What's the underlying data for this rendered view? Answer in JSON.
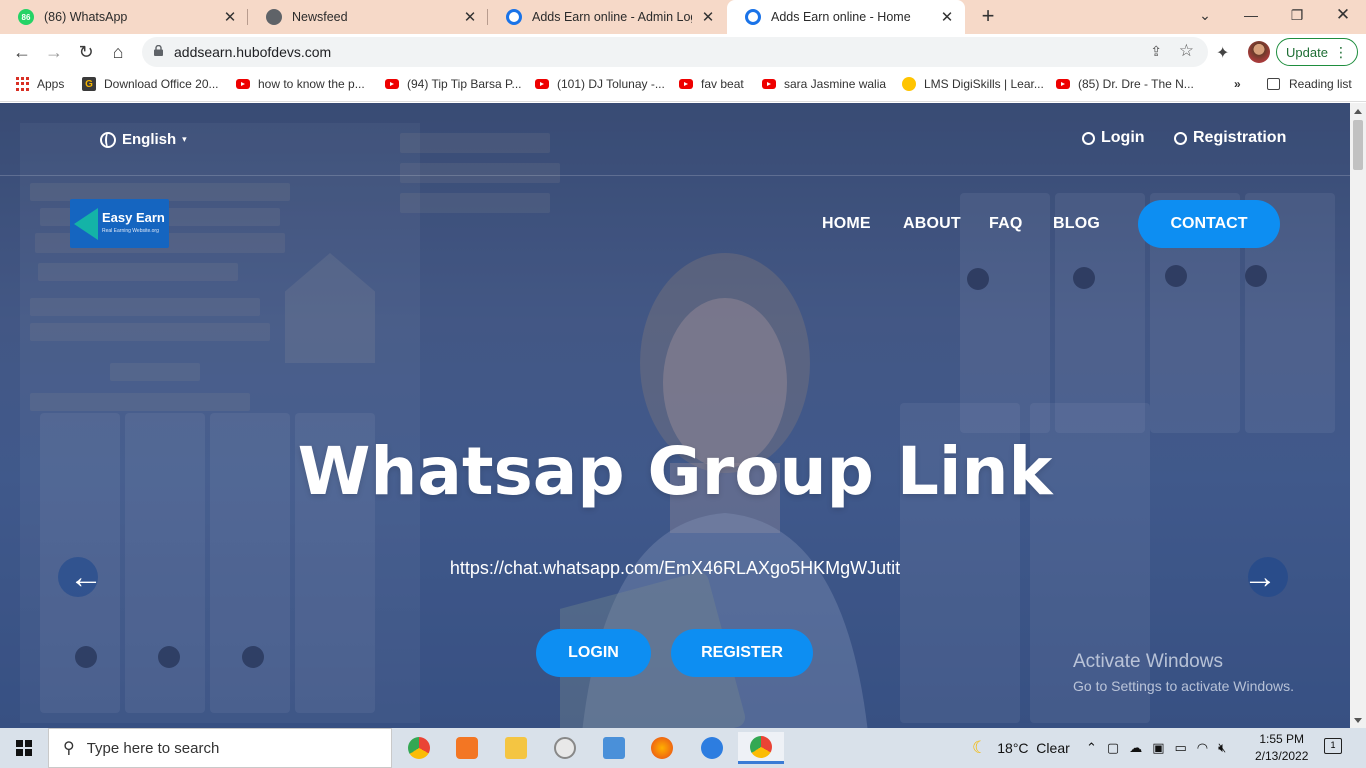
{
  "browser": {
    "tabs": [
      {
        "title": "(86) WhatsApp",
        "badge": "86",
        "favicon": "whatsapp-icon"
      },
      {
        "title": "Newsfeed",
        "favicon": "globe-icon"
      },
      {
        "title": "Adds Earn online - Admin Login",
        "favicon": "site-icon"
      },
      {
        "title": "Adds Earn online - Home",
        "favicon": "site-icon",
        "active": true
      }
    ],
    "new_tab": "+",
    "url": "addsearn.hubofdevs.com",
    "update_label": "Update",
    "bookmarks": [
      {
        "label": "Apps"
      },
      {
        "label": "Download Office 20..."
      },
      {
        "label": "how to know the p..."
      },
      {
        "label": "(94) Tip Tip Barsa P..."
      },
      {
        "label": "(101) DJ Tolunay -..."
      },
      {
        "label": "fav beat"
      },
      {
        "label": "sara Jasmine walia"
      },
      {
        "label": "LMS DigiSkills | Lear..."
      },
      {
        "label": "(85) Dr. Dre - The N..."
      }
    ],
    "more_bookmarks": "»",
    "reading_list": "Reading list"
  },
  "site": {
    "language": "English",
    "login": "Login",
    "registration": "Registration",
    "logo": {
      "name": "Easy Earn",
      "tagline": "Real Earning Website.org"
    },
    "menu": [
      "HOME",
      "ABOUT",
      "FAQ",
      "BLOG"
    ],
    "contact": "CONTACT",
    "hero": {
      "title": "Whatsap Group Link",
      "link": "https://chat.whatsapp.com/EmX46RLAXgo5HKMgWJutit",
      "login_btn": "LOGIN",
      "register_btn": "REGISTER"
    },
    "accent_color": "#0d8ef2"
  },
  "watermark": {
    "line1": "Activate Windows",
    "line2": "Go to Settings to activate Windows."
  },
  "taskbar": {
    "search_placeholder": "Type here to search",
    "weather": "18°C  Clear",
    "time": "1:55 PM",
    "date": "2/13/2022",
    "notifications": "1"
  }
}
